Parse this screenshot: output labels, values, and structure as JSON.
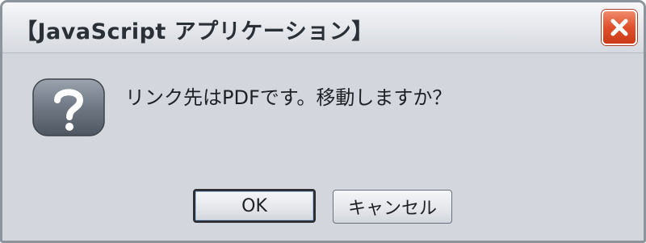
{
  "window": {
    "title": "【JavaScript アプリケーション】",
    "close_icon": "close-icon"
  },
  "dialog": {
    "icon": "question-icon",
    "message": "リンク先はPDFです。移動しますか？"
  },
  "buttons": {
    "ok_label": "OK",
    "cancel_label": "キャンセル"
  },
  "colors": {
    "title_bar": "#e7e9ed",
    "dialog_bg": "#d3d6dc",
    "close_button": "#e0502c",
    "icon_bg": "#6f7884"
  }
}
